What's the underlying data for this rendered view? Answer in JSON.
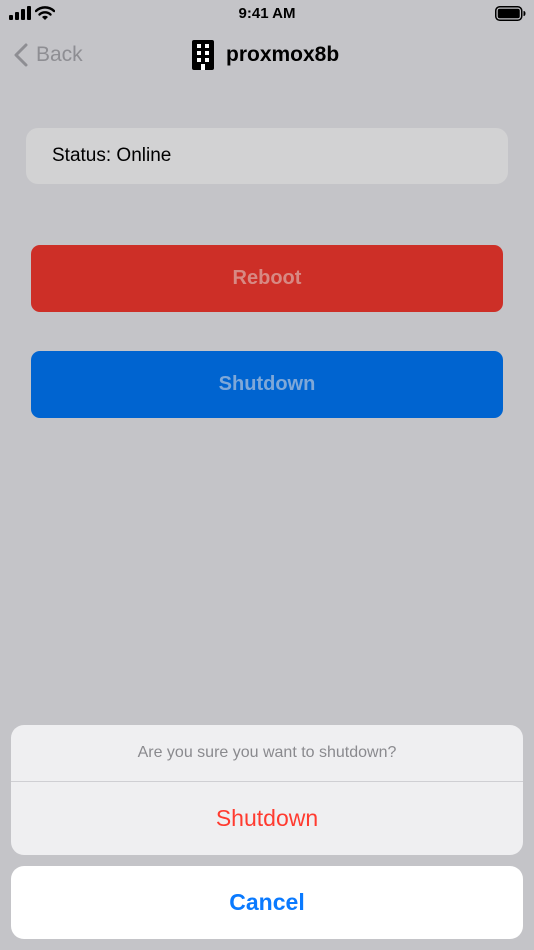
{
  "status_bar": {
    "time": "9:41 AM",
    "icons": [
      "signal-icon",
      "wifi-icon",
      "battery-icon"
    ]
  },
  "nav": {
    "back_label": "Back",
    "back_icon": "chevron-left-icon",
    "title_icon": "server-icon",
    "title": "proxmox8b"
  },
  "status": {
    "text": "Status: Online"
  },
  "buttons": {
    "reboot_label": "Reboot",
    "shutdown_label": "Shutdown"
  },
  "action_sheet": {
    "message": "Are you sure you want to shutdown?",
    "confirm_label": "Shutdown",
    "cancel_label": "Cancel"
  },
  "colors": {
    "background": "#c4c4c8",
    "reboot": "#cd2f27",
    "shutdown": "#0064d0",
    "destructive": "#ff3b30",
    "tint": "#0a7aff"
  }
}
